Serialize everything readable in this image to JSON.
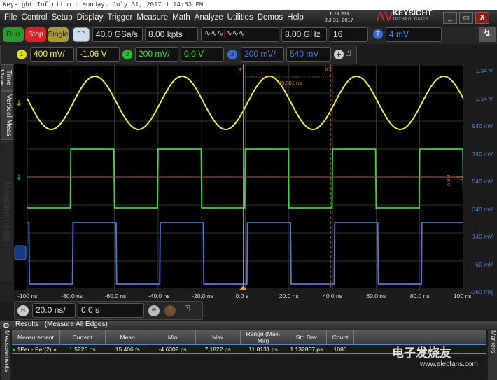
{
  "title": "Keysight Infiniium : Monday, July 31, 2017 1:14:53 PM",
  "menu": [
    "File",
    "Control",
    "Setup",
    "Display",
    "Trigger",
    "Measure",
    "Math",
    "Analyze",
    "Utilities",
    "Demos",
    "Help"
  ],
  "clock": {
    "time": "1:14 PM",
    "date": "Jul 31, 2017"
  },
  "brand": {
    "name": "KEYSIGHT",
    "sub": "TECHNOLOGIES"
  },
  "toolbar": {
    "run": "Run",
    "stop": "Stop",
    "single": "Single",
    "sample_rate": "40.0 GSa/s",
    "memory": "8.00 kpts",
    "bandwidth": "8.00 GHz",
    "averages": "16",
    "trigger_badge": "T",
    "trigger_level": "4 mV"
  },
  "channels": [
    {
      "num": "1",
      "scale": "400 mV/",
      "offset": "-1.06 V",
      "color": "#f0f020"
    },
    {
      "num": "2",
      "scale": "200 mV/",
      "offset": "0.0 V",
      "color": "#30e030"
    },
    {
      "num": "3",
      "scale": "200 mV/",
      "offset": "540 mV",
      "color": "#4a7ae0"
    }
  ],
  "side_tabs": {
    "time": "Time Meas",
    "vertical": "Vertical Meas",
    "measurements": "Measurements"
  },
  "y_axis_labels": [
    "1.34 V",
    "1.14 V",
    "940 mV",
    "740 mV",
    "540 mV",
    "340 mV",
    "140 mV",
    "-60 mV",
    "-260 mV"
  ],
  "x_axis_labels": [
    "-100 ns",
    "-80.0 ns",
    "-60.0 ns",
    "-40.0 ns",
    "-20.0 ns",
    "0.0 s",
    "20.0 ns",
    "40.0 ns",
    "60.0 ns",
    "80.0 ns",
    "100 ns"
  ],
  "axis_channel": "3",
  "cursors": {
    "x1": "X1",
    "x2": "X2",
    "delta": "40.001 ns",
    "y2": "Y2",
    "y_readout": "0.0 V",
    "x1_ns": 0,
    "x2_ns": 40
  },
  "waveforms": {
    "ch1": {
      "type": "sine",
      "period_ns": 40,
      "trough_ns": -9,
      "center_v": 0,
      "amplitude_v": 0.38,
      "scale_v": 0.4,
      "offset_v": -1.06
    },
    "ch2": {
      "type": "square",
      "period_ns": 40,
      "rise_ns": -80,
      "high_ns": 20,
      "high_v": 0.2,
      "low_v": -0.22,
      "scale_v": 0.2,
      "offset_v": 0
    },
    "ch3": {
      "type": "square",
      "period_ns": 40,
      "rise_ns": -79,
      "high_ns": 20,
      "high_v": 0.215,
      "low_v": -0.225,
      "scale_v": 0.2,
      "offset_v": 0.54
    }
  },
  "horizontal": {
    "badge": "H",
    "scale": "20.0 ns/",
    "position": "0.0 s"
  },
  "results": {
    "title": "Results",
    "subtitle": "(Measure All Edges)",
    "markers_tab": "Markers",
    "columns": [
      "Measurement",
      "Current",
      "Mean",
      "Min",
      "Max",
      "Range (Max-Min)",
      "Std Dev",
      "Count"
    ],
    "rows": [
      [
        "1Per - Per(2)",
        "1.5226 ps",
        "15.406 fs",
        "-4.6309 ps",
        "7.1822 ps",
        "11.8131 ps",
        "1.132867 ps",
        "1086"
      ]
    ]
  },
  "watermark": {
    "cn": "电子发烧友",
    "url": "www.elecfans.com"
  }
}
